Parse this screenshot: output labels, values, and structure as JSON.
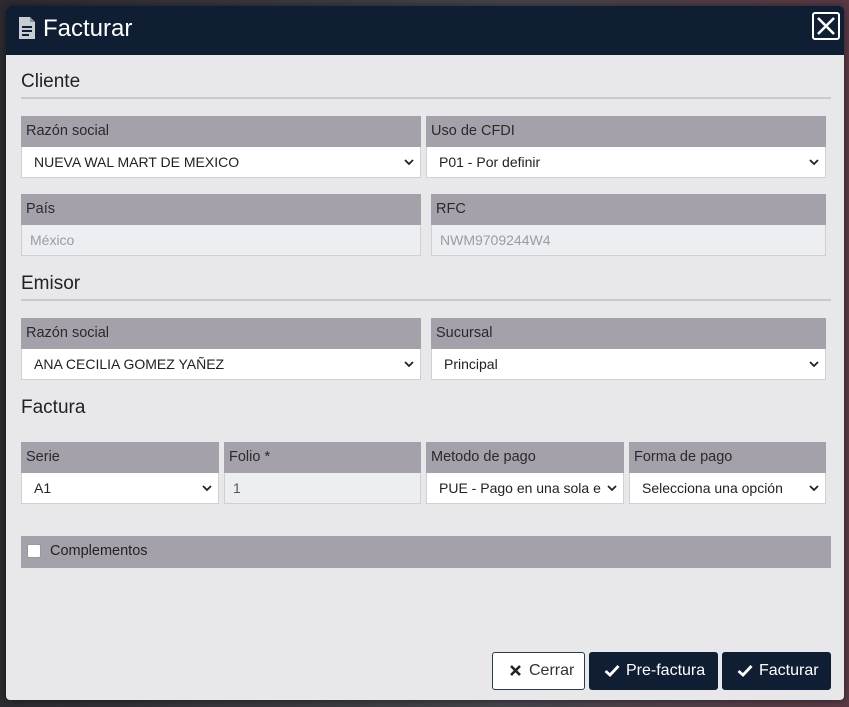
{
  "dialog": {
    "title": "Facturar",
    "close_label": "close"
  },
  "cliente": {
    "section_title": "Cliente",
    "razon_social": {
      "label": "Razón social",
      "value": "NUEVA WAL MART DE MEXICO"
    },
    "uso_cfdi": {
      "label": "Uso de CFDI",
      "value": "P01 - Por definir"
    },
    "pais": {
      "label": "País",
      "value": "México"
    },
    "rfc": {
      "label": "RFC",
      "value": "NWM9709244W4"
    }
  },
  "emisor": {
    "section_title": "Emisor",
    "razon_social": {
      "label": "Razón social",
      "value": "ANA CECILIA GOMEZ YAÑEZ"
    },
    "sucursal": {
      "label": "Sucursal",
      "value": "Principal"
    }
  },
  "factura": {
    "section_title": "Factura",
    "serie": {
      "label": "Serie",
      "value": "A1"
    },
    "folio": {
      "label": "Folio *",
      "value": "1"
    },
    "metodo_pago": {
      "label": "Metodo de pago",
      "value": "PUE - Pago en una sola exhibición"
    },
    "forma_pago": {
      "label": "Forma de pago",
      "value": "Selecciona una opción"
    }
  },
  "complementos": {
    "label": "Complementos",
    "checked": false
  },
  "buttons": {
    "cerrar": "Cerrar",
    "prefactura": "Pre-factura",
    "facturar": "Facturar"
  },
  "colors": {
    "header": "#0f1e33",
    "label_bg": "#a5a1ab",
    "body_bg": "#e8e8eb"
  }
}
